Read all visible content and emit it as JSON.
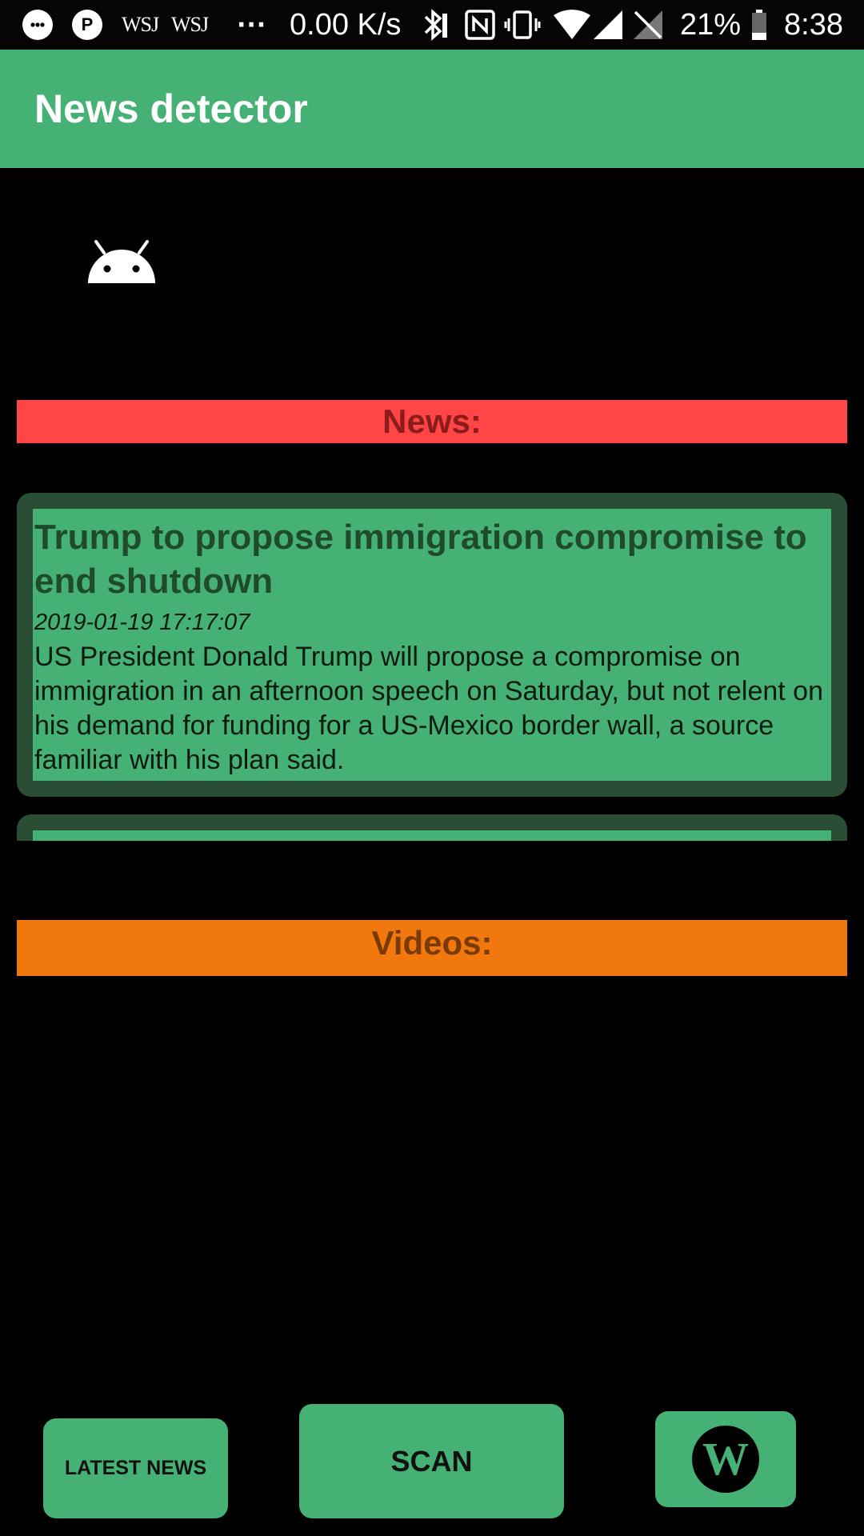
{
  "status_bar": {
    "notifications": [
      "chat-bubble-icon",
      "pinterest-icon"
    ],
    "wsj_1": "WSJ",
    "wsj_2": "WSJ",
    "more": "···",
    "network_speed": "0.00 K/s",
    "battery_percent": "21%",
    "time": "8:38"
  },
  "app_bar": {
    "title": "News detector",
    "color": "#45b174"
  },
  "sections": {
    "news_label": "News:",
    "news_color": "#ff4545",
    "videos_label": "Videos:",
    "videos_color": "#f0780d"
  },
  "news": [
    {
      "title": "Trump to propose immigration compromise to end shutdown",
      "date": "2019-01-19 17:17:07",
      "summary": "US President Donald Trump will propose a compromise on immigration in an afternoon speech on Saturday, but not relent on his demand for funding for a US-Mexico border wall, a source familiar with his plan said."
    }
  ],
  "buttons": {
    "latest_news": "LATEST NEWS",
    "scan": "SCAN",
    "wiki_icon": "W"
  }
}
